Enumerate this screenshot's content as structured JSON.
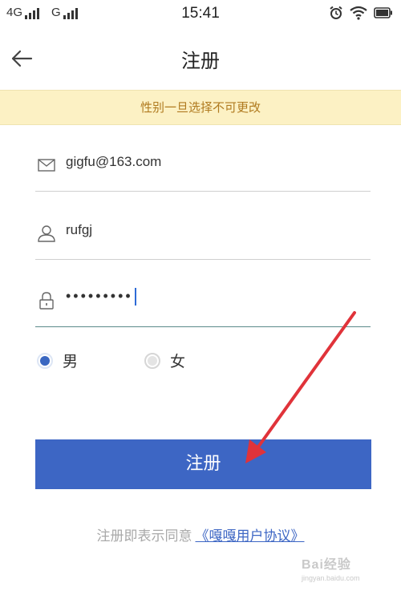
{
  "status_bar": {
    "signal_1_label": "4G",
    "signal_2_label": "G",
    "time": "15:41",
    "icons": [
      "alarm-icon",
      "wifi-icon",
      "battery-icon"
    ]
  },
  "navbar": {
    "back_icon": "arrow-left-icon",
    "title": "注册"
  },
  "notice": {
    "text": "性别一旦选择不可更改"
  },
  "form": {
    "email": {
      "icon": "envelope-icon",
      "value": "gigfu@163.com"
    },
    "username": {
      "icon": "user-icon",
      "value": "rufgj"
    },
    "password": {
      "icon": "lock-icon",
      "value": "•••••••••"
    }
  },
  "gender": {
    "options": [
      {
        "label": "男",
        "selected": true
      },
      {
        "label": "女",
        "selected": false
      }
    ]
  },
  "register_button": {
    "label": "注册"
  },
  "agreement": {
    "prefix": "注册即表示同意",
    "link": "《嘎嘎用户协议》"
  },
  "watermark": {
    "main": "Bai经验",
    "sub": "jingyan.baidu.com"
  },
  "colors": {
    "accent": "#3d66c4",
    "notice_bg": "#fcf1c4",
    "notice_text": "#b07a1f",
    "annotation_arrow": "#e0333a"
  }
}
